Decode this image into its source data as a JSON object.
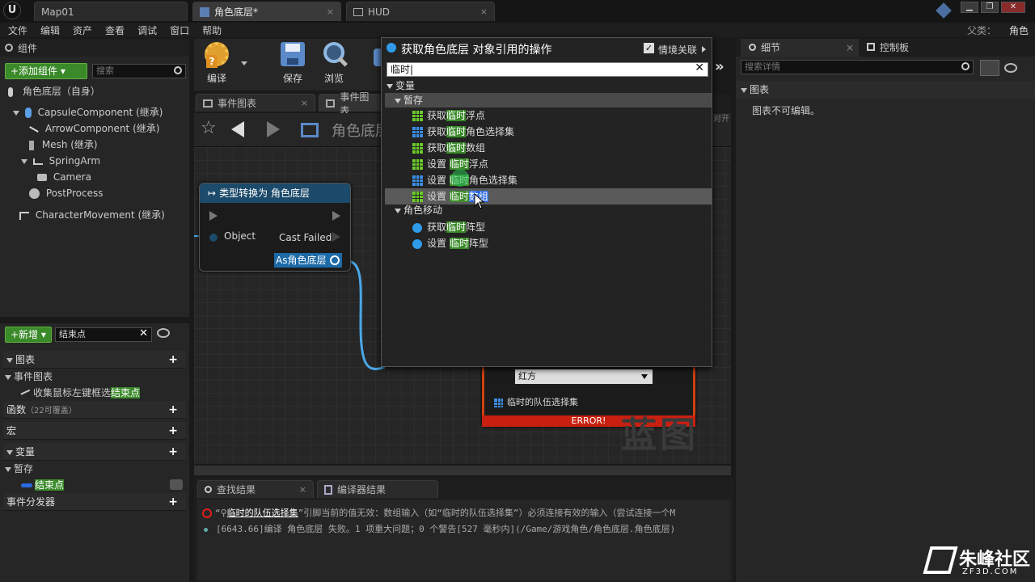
{
  "titlebar": {
    "logo": "U",
    "tabs": [
      {
        "label": "Map01"
      },
      {
        "label": "角色底层*"
      },
      {
        "label": "HUD"
      }
    ],
    "close": "×",
    "window_buttons": [
      "▁",
      "❐",
      "✕"
    ]
  },
  "menu": [
    "文件",
    "编辑",
    "资产",
    "查看",
    "调试",
    "窗口",
    "帮助"
  ],
  "parent": {
    "label": "父类：",
    "value": "角色"
  },
  "components": {
    "title": "组件",
    "add_button": "+添加组件 ▾",
    "search_placeholder": "搜索",
    "root": "角色底层（自身）",
    "items": [
      {
        "label": "CapsuleComponent (继承)"
      },
      {
        "label": "ArrowComponent (继承)"
      },
      {
        "label": "Mesh (继承)"
      },
      {
        "label": "SpringArm"
      },
      {
        "label": "Camera"
      },
      {
        "label": "PostProcess"
      },
      {
        "label": "CharacterMovement (继承)"
      }
    ]
  },
  "toolbar": {
    "compile": "编译",
    "save": "保存",
    "browse": "浏览"
  },
  "graph_tabs": [
    {
      "label": "事件图表"
    },
    {
      "label": "事件图表"
    }
  ],
  "breadcrumb": "角色底层",
  "cast_node": {
    "title": "类型转换为 角色底层",
    "pin_object": "Object",
    "pin_cast_failed": "Cast Failed",
    "pin_as": "As角色底层"
  },
  "error_node": {
    "dropdown_value": "红方",
    "var_label": "临时的队伍选择集",
    "error_label": "ERROR!"
  },
  "watermark": "蓝图",
  "mybp": {
    "new_button": "+新增 ▾",
    "search_value": "结束点",
    "sections": {
      "graphs": "图表",
      "event_graph": "事件图表",
      "event_item_prefix": "收集鼠标左键框选",
      "event_item_hl": "结束点",
      "functions": "函数",
      "functions_note": "（22可覆盖）",
      "macros": "宏",
      "variables": "变量",
      "temp": "暂存",
      "var_item": "结束点",
      "dispatchers": "事件分发器"
    },
    "plus": "+"
  },
  "context_menu": {
    "title": "获取角色底层 对象引用的操作",
    "context_label": "情境关联",
    "search_value": "临时",
    "cat_variables": "变量",
    "cat_temp": "暂存",
    "items_temp": [
      {
        "pre": "获取",
        "hl": "临时",
        "post": "浮点",
        "icon": "green"
      },
      {
        "pre": "获取",
        "hl": "临时",
        "post": "角色选择集",
        "icon": "blue"
      },
      {
        "pre": "获取",
        "hl": "临时",
        "post": "数组",
        "icon": "green"
      },
      {
        "pre": "设置 ",
        "hl": "临时",
        "post": "浮点",
        "icon": "green"
      },
      {
        "pre": "设置 ",
        "hl": "临时",
        "post": "角色选择集",
        "icon": "blue"
      },
      {
        "pre": "设置 ",
        "hl": "临时",
        "post": "数组",
        "icon": "green"
      }
    ],
    "cat_movement": "角色移动",
    "items_movement": [
      {
        "pre": "获取",
        "hl": "临时",
        "post": "阵型"
      },
      {
        "pre": "设置 ",
        "hl": "临时",
        "post": "阵型"
      }
    ]
  },
  "details": {
    "tab_details": "细节",
    "tab_palette": "控制板",
    "search_placeholder": "搜索详情",
    "section": "图表",
    "message": "图表不可编辑。",
    "right_cut": "对开"
  },
  "bottom": {
    "tab_find": "查找结果",
    "tab_compiler": "编译器结果",
    "error_line_pre": "“",
    "error_line_name": "临时的队伍选择集",
    "error_line_msg": "”引脚当前的值无效：数组输入（如“临时的队伍选择集”）必须连接有效的输入（尝试连接一个M",
    "info_line": "[6643.66]编译 角色底层 失败。1 项重大问题；0 个警告[527 毫秒内](/Game/游戏角色/角色底层.角色底层)"
  },
  "logo_watermark": {
    "text": "朱峰社区",
    "sub": "ZF3D.COM"
  }
}
